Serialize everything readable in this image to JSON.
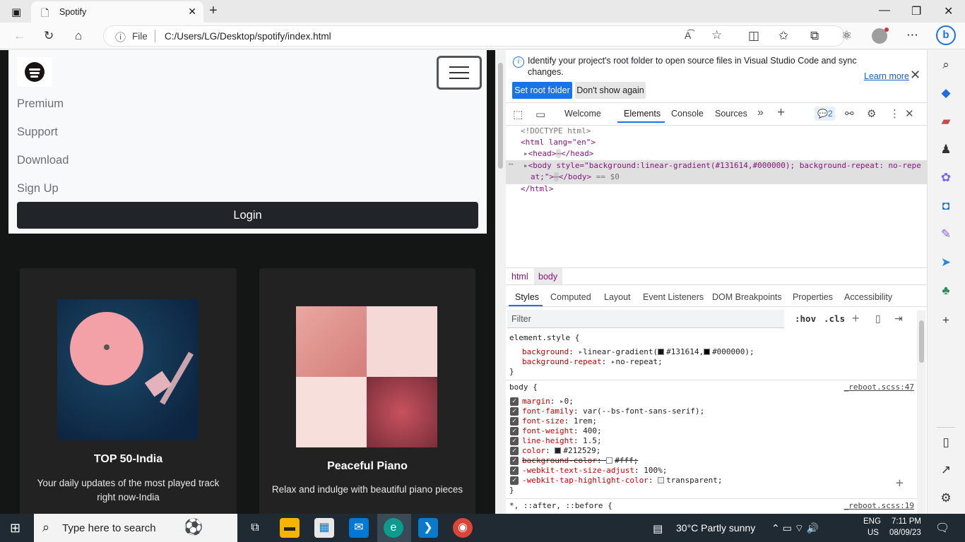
{
  "browser": {
    "tab_title": "Spotify",
    "omnibox": {
      "scheme_label": "File",
      "url": "C:/Users/LG/Desktop/spotify/index.html"
    }
  },
  "page": {
    "nav_links": [
      "Premium",
      "Support",
      "Download",
      "Sign Up"
    ],
    "login_label": "Login",
    "cards": [
      {
        "title": "TOP 50-India",
        "description": "Your daily updates of the most played track right now-India"
      },
      {
        "title": "Peaceful Piano",
        "description": "Relax and indulge with beautiful piano pieces"
      }
    ]
  },
  "devtools": {
    "info_message": "Identify your project's root folder to open source files in Visual Studio Code and sync changes.",
    "learn_more": "Learn more",
    "set_root_folder": "Set root folder",
    "dont_show_again": "Don't show again",
    "tabs": [
      "Welcome",
      "Elements",
      "Console",
      "Sources"
    ],
    "issues_count": "2",
    "dom": {
      "doctype": "<!DOCTYPE html>",
      "html_open": "<html lang=\"en\">",
      "head": "<head>",
      "head_close": "</head>",
      "body_open_pre": "<body style=\"background:linear-gradient(#131614,#000000); background-repeat: no-repe",
      "body_open_post": "at;\">",
      "body_close": "</body>",
      "body_marker": "== $0",
      "html_close": "</html>"
    },
    "breadcrumbs": [
      "html",
      "body"
    ],
    "style_tabs": [
      "Styles",
      "Computed",
      "Layout",
      "Event Listeners",
      "DOM Breakpoints",
      "Properties",
      "Accessibility"
    ],
    "filter_placeholder": "Filter",
    "filter_tools": [
      ":hov",
      ".cls"
    ],
    "rules": {
      "element_style_selector": "element.style {",
      "element_style": [
        {
          "prop": "background",
          "value": "linear-gradient(",
          "c1": "#131614",
          "c2": "#000000",
          "tail": ");"
        },
        {
          "prop": "background-repeat",
          "value": "no-repeat;"
        }
      ],
      "body_selector": "body {",
      "body_source": "_reboot.scss:47",
      "body_props": [
        {
          "prop": "margin",
          "value": "0;"
        },
        {
          "prop": "font-family",
          "value": "var(--bs-font-sans-serif);"
        },
        {
          "prop": "font-size",
          "value": "1rem;"
        },
        {
          "prop": "font-weight",
          "value": "400;"
        },
        {
          "prop": "line-height",
          "value": "1.5;"
        },
        {
          "prop": "color",
          "value": "#212529;"
        },
        {
          "prop": "background-color",
          "value": "#fff;"
        },
        {
          "prop": "-webkit-text-size-adjust",
          "value": "100%;"
        },
        {
          "prop": "-webkit-tap-highlight-color",
          "value": "transparent;"
        }
      ],
      "universal_selector": "*, ::after, ::before {",
      "universal_source": "_reboot.scss:19",
      "close_brace": "}"
    }
  },
  "taskbar": {
    "search_placeholder": "Type here to search",
    "weather": "30°C  Partly sunny",
    "lang_top": "ENG",
    "lang_bottom": "US",
    "time": "7:11 PM",
    "date": "08/09/23"
  },
  "colors": {
    "page_background": "#131614",
    "card_background": "#222222",
    "login_button": "#212529",
    "devtools_accent": "#1a73e8"
  }
}
